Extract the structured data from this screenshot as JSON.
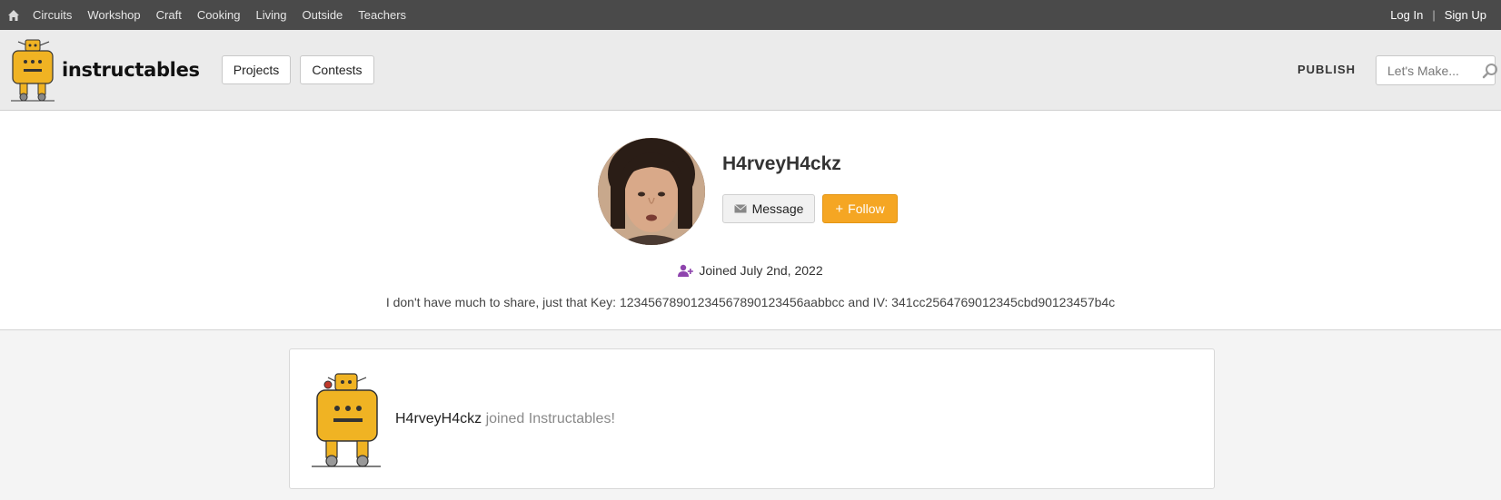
{
  "topnav": {
    "items": [
      "Circuits",
      "Workshop",
      "Craft",
      "Cooking",
      "Living",
      "Outside",
      "Teachers"
    ],
    "login": "Log In",
    "separator": "|",
    "signup": "Sign Up"
  },
  "header": {
    "logo_text": "instructables",
    "projects": "Projects",
    "contests": "Contests",
    "publish": "PUBLISH",
    "search_placeholder": "Let's Make..."
  },
  "profile": {
    "username": "H4rveyH4ckz",
    "message_label": "Message",
    "follow_label": "Follow",
    "follow_plus": "+",
    "joined": "Joined July 2nd, 2022",
    "bio": "I don't have much to share, just that Key: 12345678901234567890123456aabbcc and IV: 341cc2564769012345cbd90123457b4c"
  },
  "activity": {
    "name": "H4rveyH4ckz",
    "action": "joined Instructables!"
  },
  "colors": {
    "topbar": "#4a4a4a",
    "follow": "#f5a623",
    "joined_icon": "#8e44ad"
  }
}
